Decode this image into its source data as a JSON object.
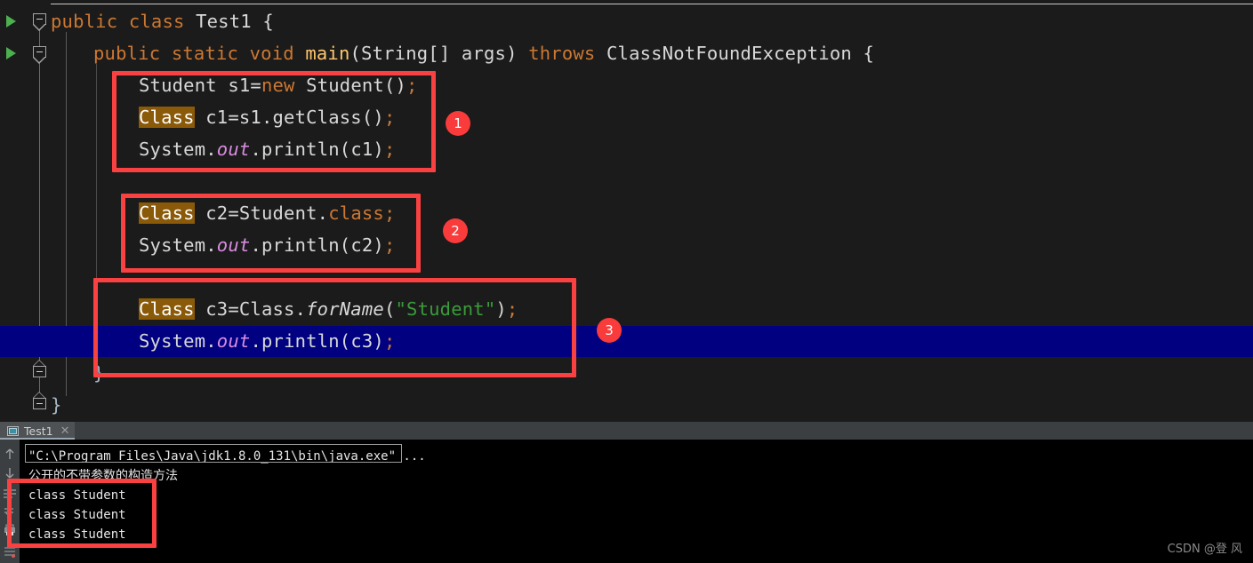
{
  "editor": {
    "lines": [
      {
        "id": "line-class-decl",
        "indent": 0,
        "segments": [
          {
            "t": "public",
            "c": "kw"
          },
          {
            "t": " ",
            "c": "plain"
          },
          {
            "t": "class",
            "c": "kw"
          },
          {
            "t": " Test1 {",
            "c": "plain"
          }
        ]
      },
      {
        "id": "line-main-decl",
        "indent": 1,
        "segments": [
          {
            "t": "public",
            "c": "kw"
          },
          {
            "t": " ",
            "c": "plain"
          },
          {
            "t": "static",
            "c": "kw"
          },
          {
            "t": " ",
            "c": "plain"
          },
          {
            "t": "void",
            "c": "kw"
          },
          {
            "t": " ",
            "c": "plain"
          },
          {
            "t": "main",
            "c": "mname"
          },
          {
            "t": "(String[] args) ",
            "c": "plain"
          },
          {
            "t": "throws",
            "c": "kw"
          },
          {
            "t": " ClassNotFoundException {",
            "c": "plain"
          }
        ]
      },
      {
        "id": "line-new-student",
        "indent": 2,
        "segments": [
          {
            "t": "Student s1=",
            "c": "plain"
          },
          {
            "t": "new",
            "c": "kw"
          },
          {
            "t": " Student()",
            "c": "plain"
          },
          {
            "t": ";",
            "c": "semi"
          }
        ]
      },
      {
        "id": "line-getclass",
        "indent": 2,
        "segments": [
          {
            "t": "Class",
            "c": "hl"
          },
          {
            "t": " c1=s1.getClass()",
            "c": "plain"
          },
          {
            "t": ";",
            "c": "semi"
          }
        ]
      },
      {
        "id": "line-println-c1",
        "indent": 2,
        "segments": [
          {
            "t": "System.",
            "c": "plain"
          },
          {
            "t": "out",
            "c": "fld"
          },
          {
            "t": ".println(c1)",
            "c": "plain"
          },
          {
            "t": ";",
            "c": "semi"
          }
        ]
      },
      {
        "id": "line-dotclass",
        "indent": 2,
        "segments": [
          {
            "t": "Class",
            "c": "hl"
          },
          {
            "t": " c2=Student.",
            "c": "plain"
          },
          {
            "t": "class",
            "c": "kw"
          },
          {
            "t": ";",
            "c": "semi"
          }
        ]
      },
      {
        "id": "line-println-c2",
        "indent": 2,
        "segments": [
          {
            "t": "System.",
            "c": "plain"
          },
          {
            "t": "out",
            "c": "fld"
          },
          {
            "t": ".println(c2)",
            "c": "plain"
          },
          {
            "t": ";",
            "c": "semi"
          }
        ]
      },
      {
        "id": "line-forname",
        "indent": 2,
        "segments": [
          {
            "t": "Class",
            "c": "hl"
          },
          {
            "t": " c3=Class.",
            "c": "plain"
          },
          {
            "t": "forName",
            "c": "it"
          },
          {
            "t": "(",
            "c": "plain"
          },
          {
            "t": "\"Student\"",
            "c": "str"
          },
          {
            "t": ")",
            "c": "plain"
          },
          {
            "t": ";",
            "c": "semi"
          }
        ]
      },
      {
        "id": "line-println-c3",
        "indent": 2,
        "segments": [
          {
            "t": "System.",
            "c": "plain"
          },
          {
            "t": "out",
            "c": "fld"
          },
          {
            "t": ".println(c3)",
            "c": "plain"
          },
          {
            "t": ";",
            "c": "semi"
          }
        ]
      },
      {
        "id": "line-close-main",
        "indent": 1,
        "segments": [
          {
            "t": "}",
            "c": "brc"
          }
        ]
      },
      {
        "id": "line-close-class",
        "indent": 0,
        "segments": [
          {
            "t": "}",
            "c": "brc"
          }
        ]
      }
    ],
    "annotations": {
      "badges": [
        "1",
        "2",
        "3"
      ],
      "box_color": "#fa4141",
      "badge_color": "#fa3b3b"
    },
    "selection_color": "#000080"
  },
  "console": {
    "tab": {
      "label": "Test1",
      "close_label": "✕",
      "icon": "console-window-icon"
    },
    "toolbar_icons": [
      "arrow-up-icon",
      "arrow-down-icon",
      "soft-wrap-icon",
      "scroll-to-end-icon",
      "print-icon",
      "clear-all-icon"
    ],
    "output_lines": [
      {
        "id": "cmd-line",
        "text": "\"C:\\Program Files\\Java\\jdk1.8.0_131\\bin\\java.exe\" ...",
        "style": "boxed"
      },
      {
        "id": "cjk-line",
        "text": "公开的不带参数的构造方法",
        "style": "cjk"
      },
      {
        "id": "out-1",
        "text": "class Student",
        "style": "plain"
      },
      {
        "id": "out-2",
        "text": "class Student",
        "style": "plain"
      },
      {
        "id": "out-3",
        "text": "class Student",
        "style": "plain"
      }
    ]
  },
  "watermark": {
    "text": "CSDN @登 风"
  }
}
